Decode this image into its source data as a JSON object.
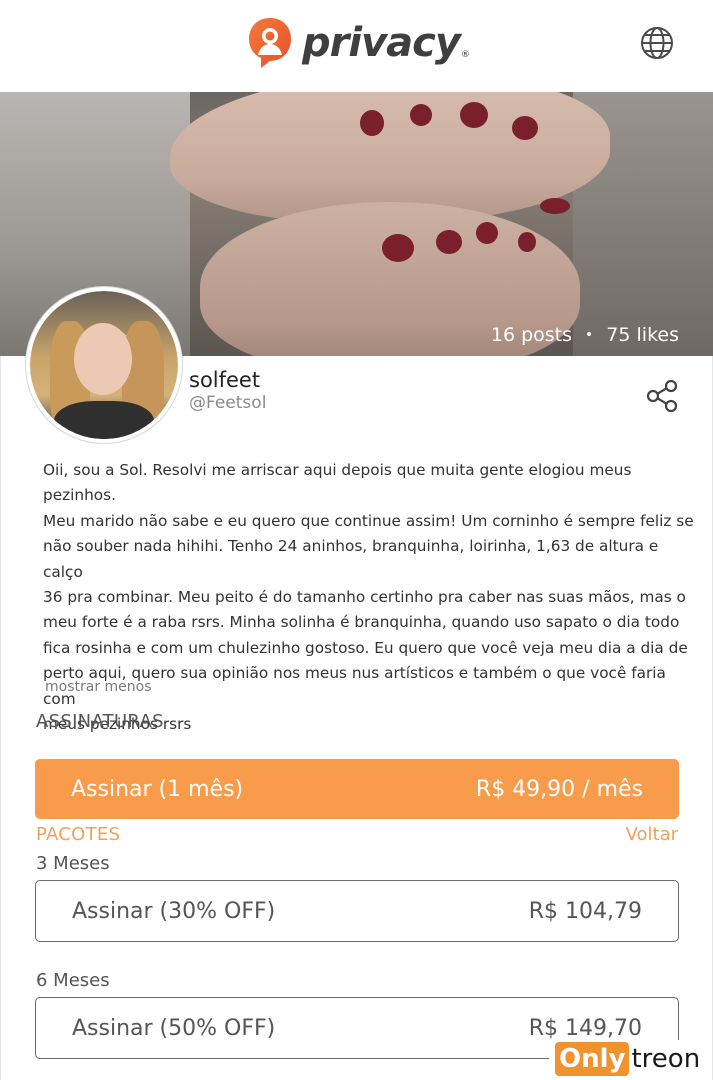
{
  "header": {
    "logo_text": "privacy",
    "logo_registered": "®",
    "language_icon": "globe-icon"
  },
  "cover": {
    "posts": "16 posts",
    "separator": "•",
    "likes": "75 likes"
  },
  "profile": {
    "name": "solfeet",
    "handle": "@Feetsol",
    "share_icon": "share-icon"
  },
  "bio": {
    "text": "Oii, sou a Sol. Resolvi me arriscar aqui depois que muita gente elogiou meus pezinhos.\nMeu marido não sabe e eu quero que continue assim! Um corninho é sempre feliz se\nnão souber nada hihihi. Tenho 24 aninhos, branquinha, loirinha, 1,63 de altura e calço\n36 pra combinar. Meu peito é do tamanho certinho pra caber nas suas mãos, mas o\nmeu forte é a raba rsrs. Minha solinha é branquinha, quando uso sapato o dia todo\nfica rosinha e com um chulezinho gostoso. Eu quero que você veja meu dia a dia de\nperto aqui, quero sua opinião nos meus nus artísticos e também o que você faria com\nmeus pezinhos rsrs",
    "toggle_label": "mostrar menos"
  },
  "subscriptions": {
    "title": "ASSINATURAS",
    "main": {
      "label": "Assinar (1 mês)",
      "price": "R$ 49,90 / mês"
    },
    "packages_title": "PACOTES",
    "back_label": "Voltar",
    "packages": [
      {
        "period": "3 Meses",
        "label": "Assinar (30% OFF)",
        "price": "R$ 104,79"
      },
      {
        "period": "6 Meses",
        "label": "Assinar (50% OFF)",
        "price": "R$ 149,70"
      }
    ]
  },
  "watermark": {
    "part1": "Only",
    "part2": "treon"
  },
  "colors": {
    "accent": "#f89b4a",
    "link": "#f0a25c",
    "logo_orange": "#f26a2e"
  }
}
